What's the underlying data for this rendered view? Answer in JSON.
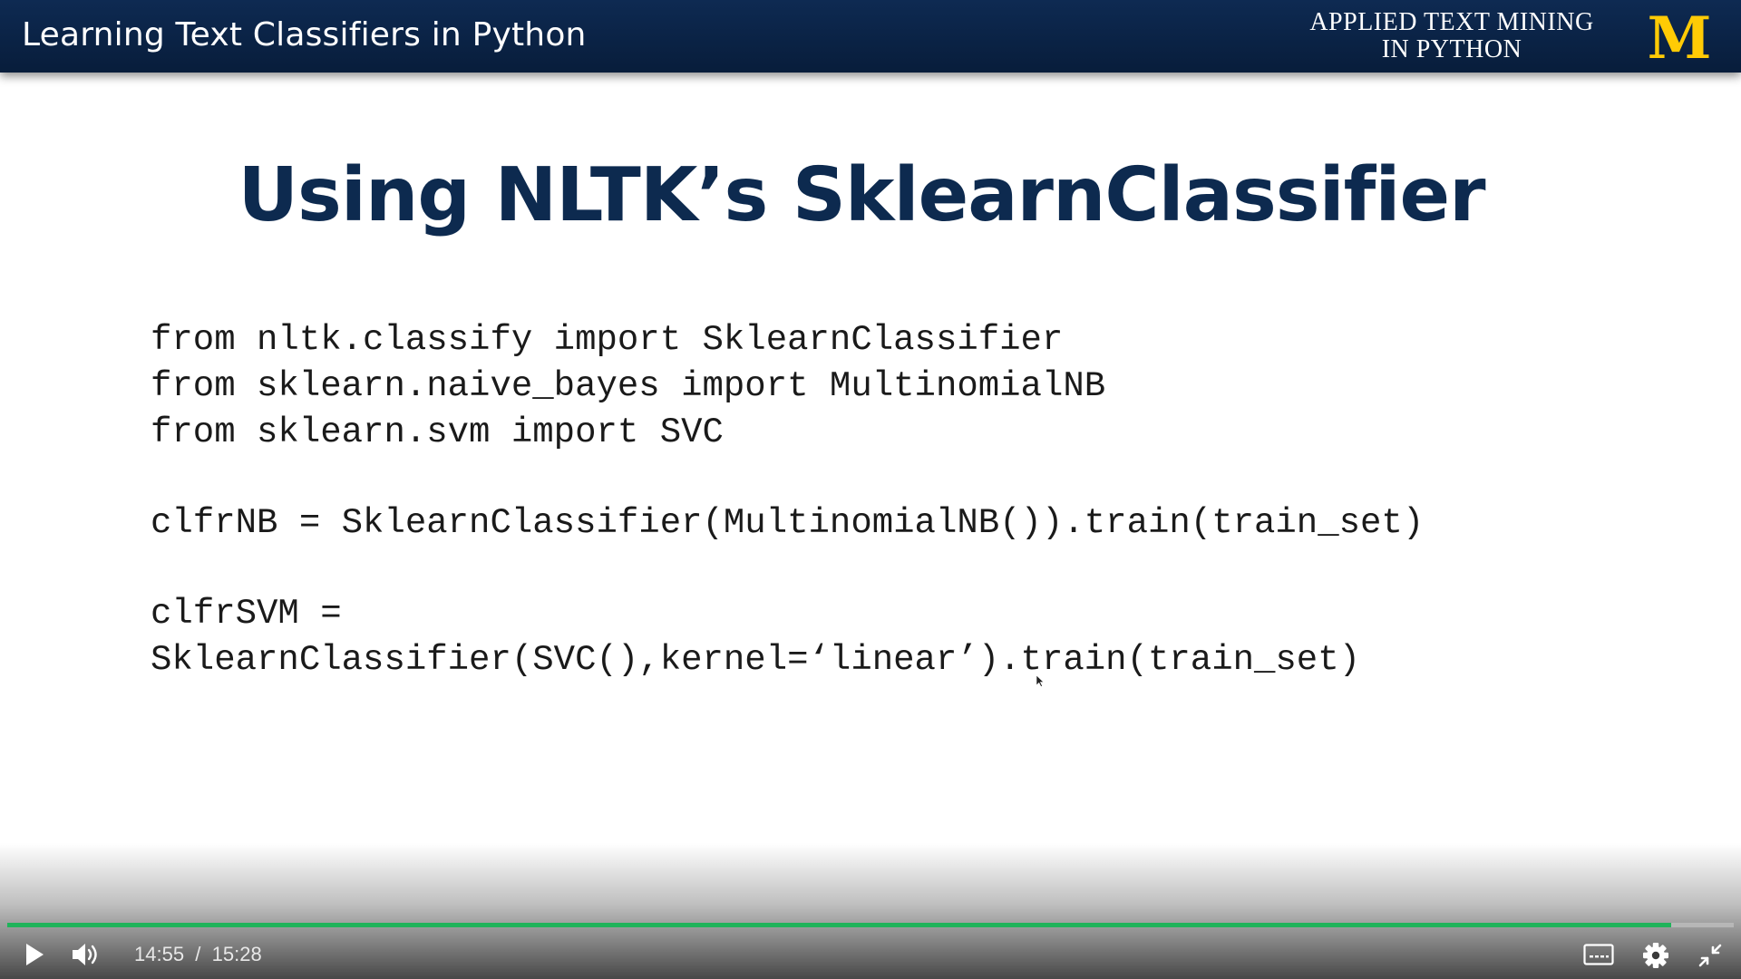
{
  "slide": {
    "header_title": "Learning Text Classifiers in Python",
    "course_title_line1": "APPLIED TEXT MINING",
    "course_title_line2": "IN PYTHON",
    "logo_letter": "M",
    "logo_color": "#FFCB05",
    "header_bg": "#0a2244",
    "heading": "Using NLTK’s SklearnClassifier",
    "heading_color": "#0d2a4f",
    "code_lines": [
      "from nltk.classify import SklearnClassifier",
      "from sklearn.naive_bayes import MultinomialNB",
      "from sklearn.svm import SVC",
      "",
      "clfrNB = SklearnClassifier(MultinomialNB()).train(train_set)",
      "",
      "clfrSVM =",
      "SklearnClassifier(SVC(),kernel=‘linear’).train(train_set)"
    ]
  },
  "player": {
    "current_time": "14:55",
    "separator": "/",
    "duration": "15:28",
    "progress_fraction": 0.964,
    "progress_color": "#1fb35a",
    "buttons": {
      "play": "play-icon",
      "volume": "volume-icon",
      "captions": "closed-captions-icon",
      "settings": "gear-icon",
      "exit_fullscreen": "exit-fullscreen-icon"
    }
  }
}
